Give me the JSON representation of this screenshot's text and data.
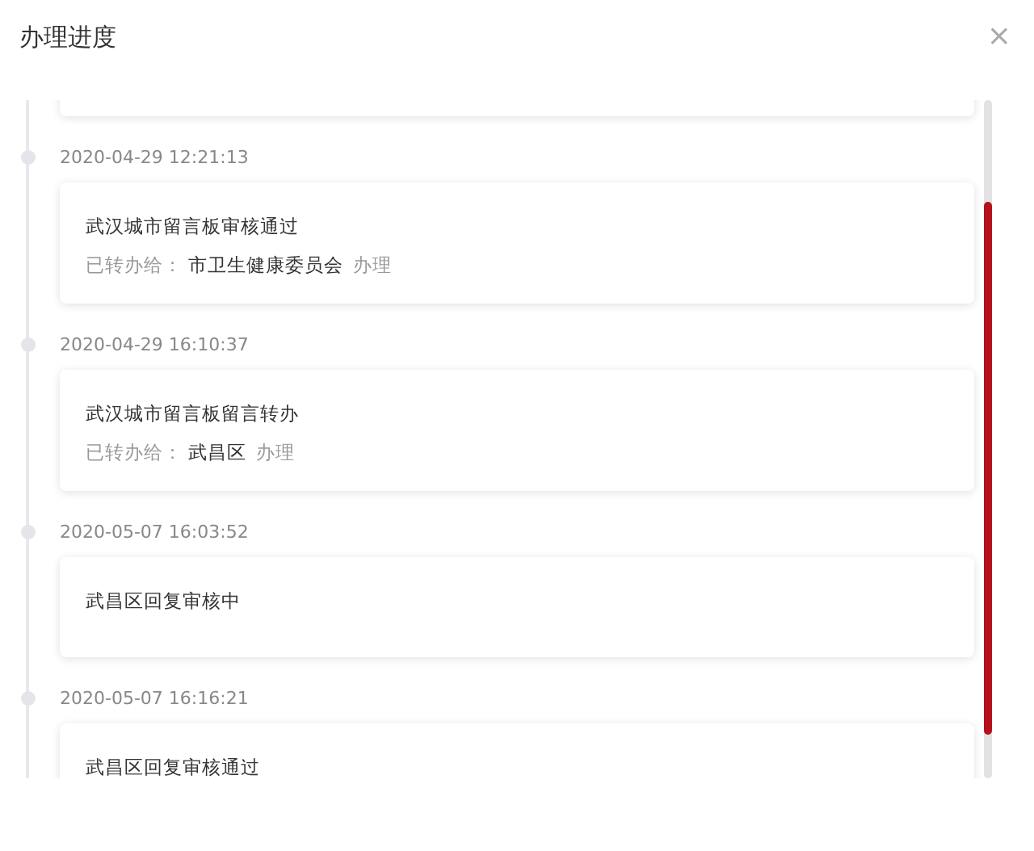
{
  "dialog": {
    "title": "办理进度",
    "close": "×"
  },
  "entries": [
    {
      "time": "2020-04-29 12:21:13",
      "title": "武汉城市留言板审核通过",
      "transfer": {
        "label": "已转办给：",
        "target": "市卫生健康委员会",
        "action": "办理"
      }
    },
    {
      "time": "2020-04-29 16:10:37",
      "title": "武汉城市留言板留言转办",
      "transfer": {
        "label": "已转办给：",
        "target": "武昌区",
        "action": "办理"
      }
    },
    {
      "time": "2020-05-07 16:03:52",
      "title": "武昌区回复审核中"
    },
    {
      "time": "2020-05-07 16:16:21",
      "title": "武昌区回复审核通过"
    }
  ]
}
